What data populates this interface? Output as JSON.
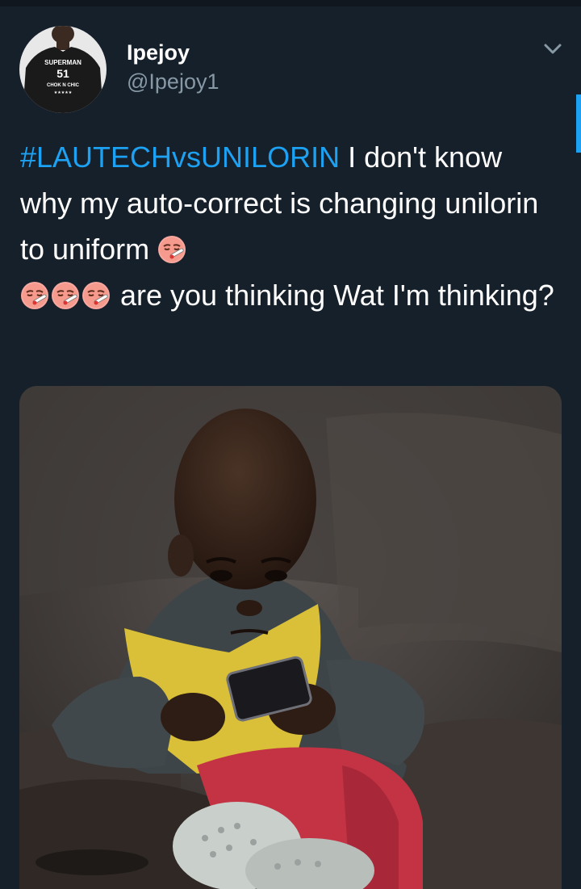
{
  "tweet": {
    "display_name": "Ipejoy",
    "handle": "@Ipejoy1",
    "hashtag": "#LAUTECHvsUNILORIN",
    "text_part1": " I don't know why my auto-correct is changing unilorin to uniform ",
    "text_part2": " are you thinking Wat I'm thinking?",
    "emoji_name": "face-with-thermometer-emoji"
  },
  "avatar": {
    "shirt_line1": "SUPERMAN",
    "shirt_number": "51",
    "shirt_line2": "CHOK N CHIC"
  },
  "media": {
    "description_icon": "photo-child-holding-phone"
  },
  "colors": {
    "background": "#15202b",
    "link": "#1da1f2",
    "secondary_text": "#8899a6",
    "primary_text": "#ffffff"
  }
}
